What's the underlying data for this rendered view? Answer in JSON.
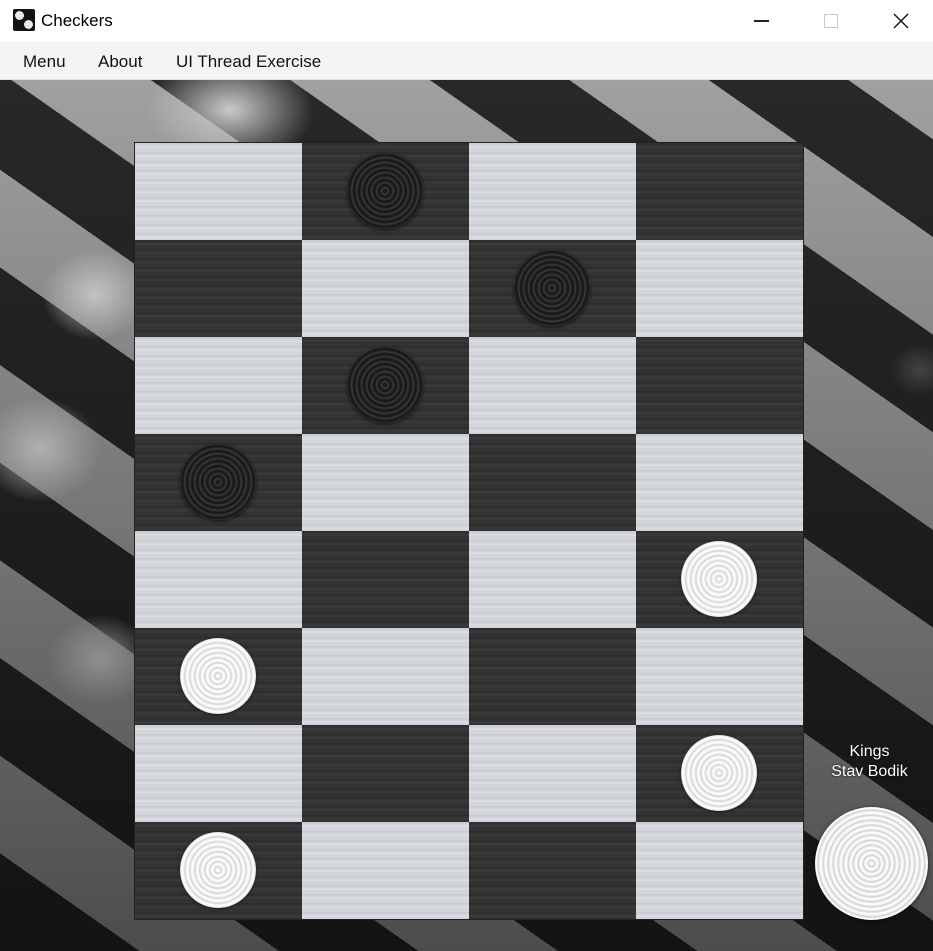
{
  "window": {
    "title": "Checkers",
    "controls": {
      "minimize": "—",
      "maximize": "☐",
      "close": "✕"
    }
  },
  "menu": {
    "items": [
      "Menu",
      "About",
      "UI Thread Exercise"
    ]
  },
  "board": {
    "columns": 4,
    "rows": 8,
    "cell_colors": {
      "light": "#d4d6db",
      "dark": "#333333"
    },
    "pieces": [
      {
        "row": 0,
        "col": 1,
        "color": "black"
      },
      {
        "row": 1,
        "col": 2,
        "color": "black"
      },
      {
        "row": 2,
        "col": 1,
        "color": "black"
      },
      {
        "row": 3,
        "col": 0,
        "color": "black"
      },
      {
        "row": 4,
        "col": 3,
        "color": "white"
      },
      {
        "row": 5,
        "col": 0,
        "color": "white"
      },
      {
        "row": 6,
        "col": 3,
        "color": "white"
      },
      {
        "row": 7,
        "col": 0,
        "color": "white"
      }
    ]
  },
  "side_panel": {
    "kings_label": "Kings",
    "player_name": "Stav Bodik",
    "turn_piece_color": "white"
  }
}
